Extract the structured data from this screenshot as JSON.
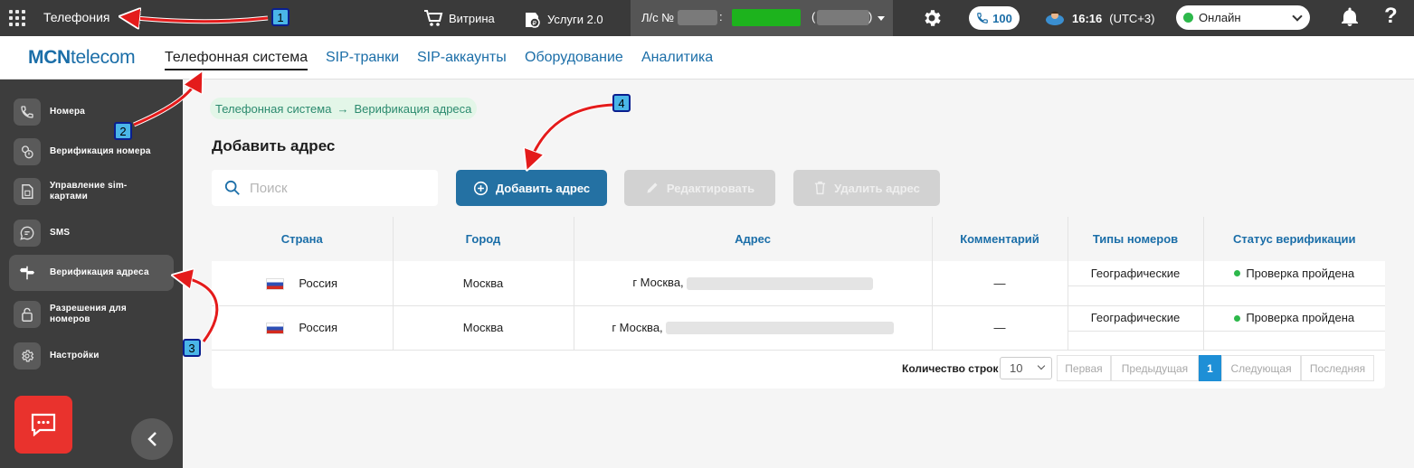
{
  "topbar": {
    "app_title": "Телефония",
    "storefront": "Витрина",
    "services": "Услуги 2.0",
    "account_label": "Л/с №",
    "colon": ":",
    "paren_open": "(",
    "paren_close": ")",
    "calls_count": "100",
    "time": "16:16",
    "timezone": "(UTC+3)",
    "status": "Онлайн",
    "help": "?"
  },
  "nav": {
    "logo_bold": "MCN",
    "logo_rest": "telecom",
    "items": [
      "Телефонная система",
      "SIP-транки",
      "SIP-аккаунты",
      "Оборудование",
      "Аналитика"
    ]
  },
  "sidebar": {
    "items": [
      {
        "label": "Номера",
        "icon": "phone-icon"
      },
      {
        "label": "Верификация номера",
        "icon": "verify-number-icon"
      },
      {
        "label": "Управление sim-картами",
        "icon": "sim-card-icon"
      },
      {
        "label": "SMS",
        "icon": "sms-icon"
      },
      {
        "label": "Верификация адреса",
        "icon": "signpost-icon"
      },
      {
        "label": "Разрешения для номеров",
        "icon": "permissions-icon"
      },
      {
        "label": "Настройки",
        "icon": "gear-icon"
      }
    ]
  },
  "breadcrumb": {
    "root": "Телефонная система",
    "separator": "→",
    "current": "Верификация адреса"
  },
  "page": {
    "title": "Добавить адрес",
    "search_placeholder": "Поиск",
    "add_button": "Добавить адрес",
    "edit_button": "Редактировать",
    "delete_button": "Удалить адрес"
  },
  "table": {
    "headers": [
      "Страна",
      "Город",
      "Адрес",
      "Комментарий",
      "Типы номеров",
      "Статус верификации"
    ],
    "rows": [
      {
        "country": "Россия",
        "city": "Москва",
        "address": "г Москва,",
        "comment": "—",
        "number_type": "Географические",
        "status": "Проверка пройдена"
      },
      {
        "country": "Россия",
        "city": "Москва",
        "address": "г Москва,",
        "comment": "—",
        "number_type": "Географические",
        "status": "Проверка пройдена"
      }
    ]
  },
  "pagination": {
    "rows_label": "Количество строк",
    "rows_value": "10",
    "first": "Первая",
    "prev": "Предыдущая",
    "current": "1",
    "next": "Следующая",
    "last": "Последняя"
  },
  "annotations": [
    "1",
    "2",
    "3",
    "4"
  ],
  "colors": {
    "accent": "#1b6ea8",
    "primary_button": "#2471a3",
    "topbar": "#3a3a3a",
    "sidebar": "#3d3d3d",
    "annotation_arrow": "#e41b1b",
    "online": "#2db84b"
  }
}
